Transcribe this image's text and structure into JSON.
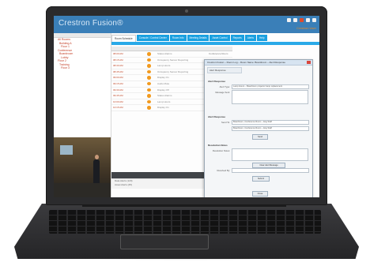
{
  "app": {
    "title": "Crestron Fusion®",
    "user": "Crestron User"
  },
  "nav": {
    "items": [
      "All Rooms",
      "Building A",
      "Floor 1",
      "Conference",
      "Boardroom",
      "Lobby",
      "Floor 2",
      "Training",
      "Floor 3"
    ]
  },
  "tabs": {
    "items": [
      {
        "label": "Room Schedule",
        "active": true
      },
      {
        "label": "Console / Control Center"
      },
      {
        "label": "Room Info"
      },
      {
        "label": "Meeting Details"
      },
      {
        "label": "Asset Control"
      },
      {
        "label": "Reports"
      },
      {
        "label": "Alerts"
      },
      {
        "label": "Help"
      }
    ]
  },
  "table": {
    "rows": [
      {
        "time": "08:00 AM",
        "text": "Status Alarms",
        "side": "Conference Room"
      },
      {
        "time": "08:15 AM",
        "text": "Occupancy Sensor Reporting",
        "side": "Conference Room"
      },
      {
        "time": "08:30 AM",
        "text": "Lamp Hours",
        "side": "Boardroom"
      },
      {
        "time": "08:45 AM",
        "text": "Occupancy Sensor Reporting",
        "side": "Boardroom"
      },
      {
        "time": "09:00 AM",
        "text": "Display On",
        "side": "Lobby"
      },
      {
        "time": "09:15 AM",
        "text": "Audio Mute",
        "side": "Lobby"
      },
      {
        "time": "09:30 AM",
        "text": "Display Off",
        "side": "Training"
      },
      {
        "time": "09:45 AM",
        "text": "Status Alarms",
        "side": "Training"
      },
      {
        "time": "10:00 AM",
        "text": "Lamp Hours",
        "side": "Floor 3"
      },
      {
        "time": "10:15 AM",
        "text": "Display On",
        "side": "Floor 3"
      }
    ],
    "footer": [
      "Data Alerts (120)",
      "Asset Alerts (45)"
    ]
  },
  "dialog": {
    "title": "Crestron Fusion – Room Log – Room Name: Boardroom – Alert Response",
    "tab": "Alert Response",
    "section1": "Alert Response",
    "label_alert": "Alert Type:",
    "alert_value": "Lamp Hours – Boardroom projector lamp replacement",
    "label_message": "Message Sent:",
    "section2": "Alert Response",
    "label_to": "Send To:",
    "to_value": "Boardroom, Conference Room – Eng Staff",
    "to_value2": "Boardroom, Conference Room – Eng Staff",
    "send_label": "Send",
    "section3": "Resolution Notes",
    "label_notes": "Resolution Notes:",
    "clear_label": "Clear Alert Message",
    "label_resolved": "Resolved By:",
    "submit_label": "Submit",
    "close_label": "Close"
  },
  "colors": {
    "topbar": "#3a7fb8",
    "tab": "#1aa0e0",
    "alert_icon": "#f29a1f"
  }
}
